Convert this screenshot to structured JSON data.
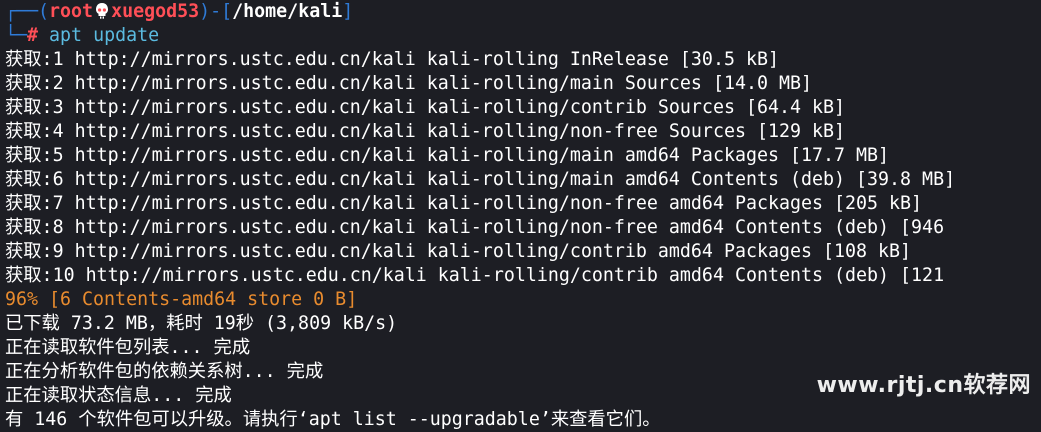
{
  "colors": {
    "background": "#1d1e24",
    "prompt_blue": "#2f7bd7",
    "prompt_red": "#ff4f57",
    "command_cyan": "#5bbbe0",
    "progress_orange": "#e88b2e",
    "text": "#ffffff"
  },
  "prompt": {
    "frame_top": "┌──(",
    "user": "root",
    "skull_icon": "skull-icon",
    "host": "xuegod53",
    "bracket_mid": ")-[",
    "path": "/home/kali",
    "bracket_end": "]",
    "frame_bottom": "└─",
    "hash": "#",
    "command": "apt update"
  },
  "output": {
    "fetch_lines": [
      "获取:1 http://mirrors.ustc.edu.cn/kali kali-rolling InRelease [30.5 kB]",
      "获取:2 http://mirrors.ustc.edu.cn/kali kali-rolling/main Sources [14.0 MB]",
      "获取:3 http://mirrors.ustc.edu.cn/kali kali-rolling/contrib Sources [64.4 kB]",
      "获取:4 http://mirrors.ustc.edu.cn/kali kali-rolling/non-free Sources [129 kB]",
      "获取:5 http://mirrors.ustc.edu.cn/kali kali-rolling/main amd64 Packages [17.7 MB]",
      "获取:6 http://mirrors.ustc.edu.cn/kali kali-rolling/main amd64 Contents (deb) [39.8 MB]",
      "获取:7 http://mirrors.ustc.edu.cn/kali kali-rolling/non-free amd64 Packages [205 kB]",
      "获取:8 http://mirrors.ustc.edu.cn/kali kali-rolling/non-free amd64 Contents (deb) [946",
      "获取:9 http://mirrors.ustc.edu.cn/kali kali-rolling/contrib amd64 Packages [108 kB]",
      "获取:10 http://mirrors.ustc.edu.cn/kali kali-rolling/contrib amd64 Contents (deb) [121"
    ],
    "progress_line": "96% [6 Contents-amd64 store 0 B]",
    "downloaded": "已下载 73.2 MB，耗时 19秒 (3,809 kB/s)",
    "reading_lists": "正在读取软件包列表... 完成",
    "building_deps": "正在分析软件包的依赖关系树... 完成",
    "reading_state": "正在读取状态信息... 完成",
    "upgradable": "有 146 个软件包可以升级。请执行‘apt list --upgradable’来查看它们。"
  },
  "watermark": {
    "text": "www.rjtj.cn软荐网"
  }
}
